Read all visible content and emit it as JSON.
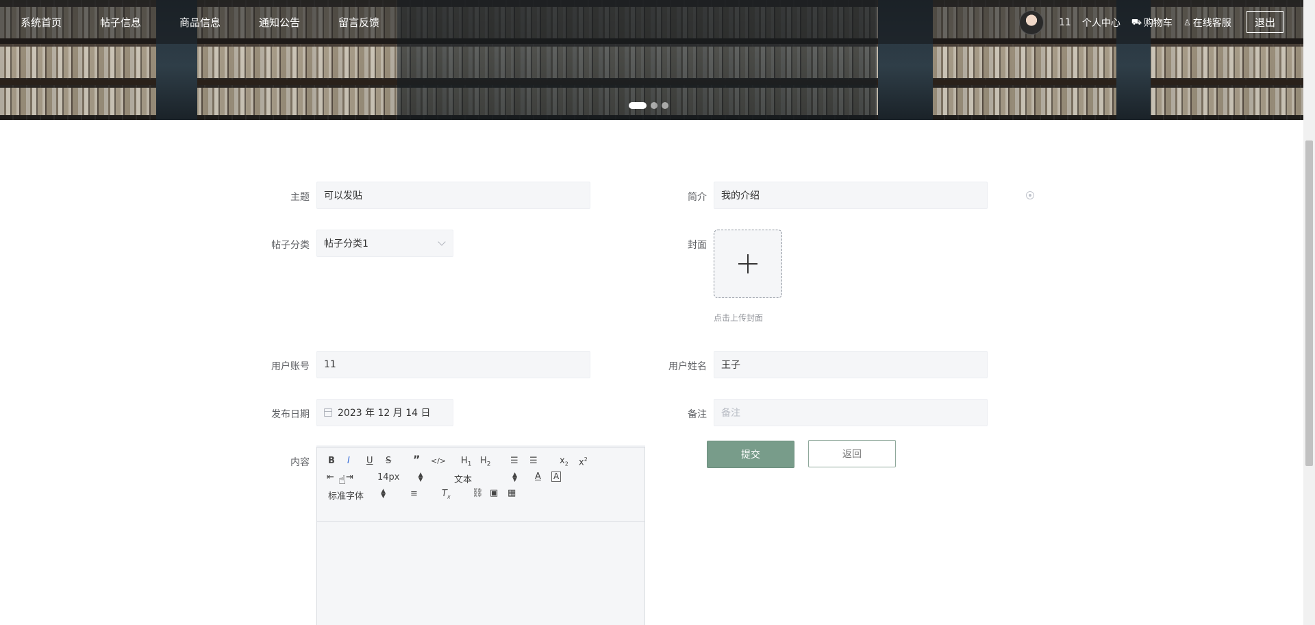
{
  "nav": {
    "items": [
      "系统首页",
      "帖子信息",
      "商品信息",
      "通知公告",
      "留言反馈"
    ],
    "user_id": "11",
    "personal_center": "个人中心",
    "cart": "购物车",
    "service": "在线客服",
    "logout": "退出"
  },
  "form": {
    "topic_label": "主题",
    "topic_value": "可以发贴",
    "intro_label": "简介",
    "intro_value": "我的介绍",
    "category_label": "帖子分类",
    "category_value": "帖子分类1",
    "cover_label": "封面",
    "cover_hint": "点击上传封面",
    "account_label": "用户账号",
    "account_value": "11",
    "name_label": "用户姓名",
    "name_value": "王子",
    "date_label": "发布日期",
    "date_value": "2023 年 12 月 14 日",
    "remark_label": "备注",
    "remark_placeholder": "备注",
    "content_label": "内容",
    "submit": "提交",
    "back": "返回"
  },
  "editor": {
    "font_size": "14px",
    "header_select": "文本",
    "font_family": "标准字体"
  },
  "colors": {
    "accent": "#789c8a",
    "input_bg": "#f5f6f8"
  }
}
